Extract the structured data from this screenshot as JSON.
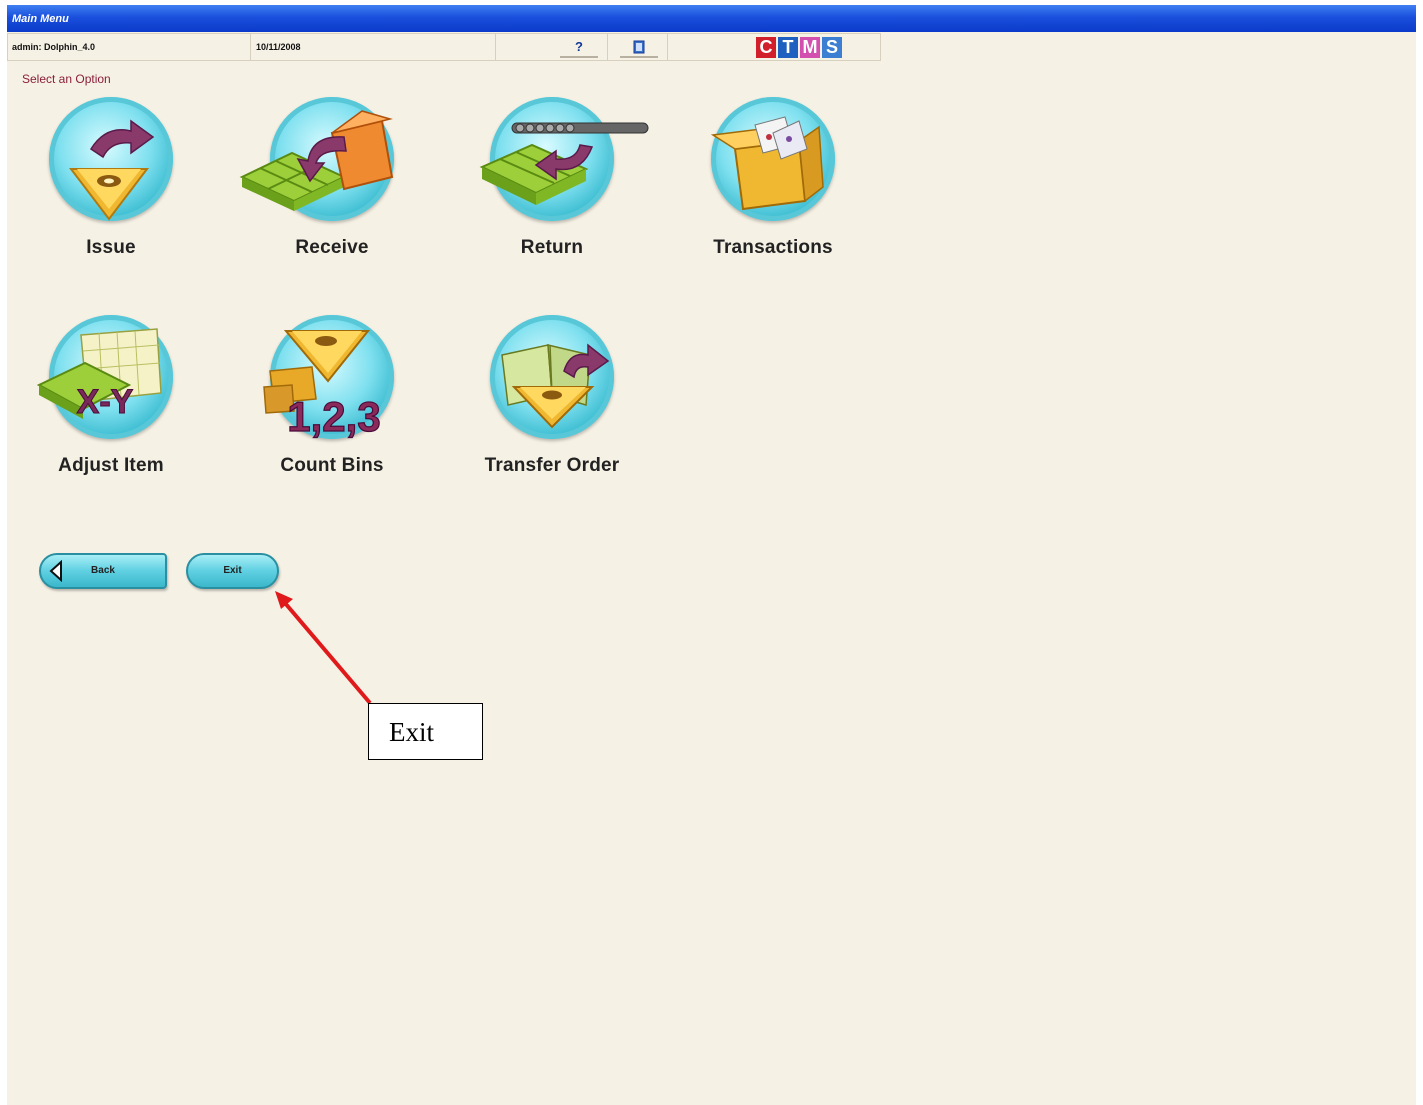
{
  "window": {
    "title": "Main Menu"
  },
  "infobar": {
    "user": "admin: Dolphin_4.0",
    "date": "10/11/2008",
    "help_icon": "help-question-icon",
    "book_icon": "book-icon",
    "logo_letters": [
      "C",
      "T",
      "M",
      "S"
    ],
    "logo_colors": [
      "#d21f2c",
      "#1f5fbf",
      "#d24fb0",
      "#3c7fd2"
    ]
  },
  "prompt": "Select an Option",
  "menu": {
    "items": [
      {
        "label": "Issue",
        "icon": "issue-icon"
      },
      {
        "label": "Receive",
        "icon": "receive-icon"
      },
      {
        "label": "Return",
        "icon": "return-icon"
      },
      {
        "label": "Transactions",
        "icon": "transactions-icon"
      },
      {
        "label": "Adjust Item",
        "icon": "adjust-item-icon"
      },
      {
        "label": "Count Bins",
        "icon": "count-bins-icon"
      },
      {
        "label": "Transfer Order",
        "icon": "transfer-order-icon"
      }
    ]
  },
  "nav": {
    "back_label": "Back",
    "exit_label": "Exit"
  },
  "annotation": {
    "label": "Exit",
    "color": "#e0191b"
  },
  "adjust_text": "X-Y",
  "count_text": "1,2,3"
}
